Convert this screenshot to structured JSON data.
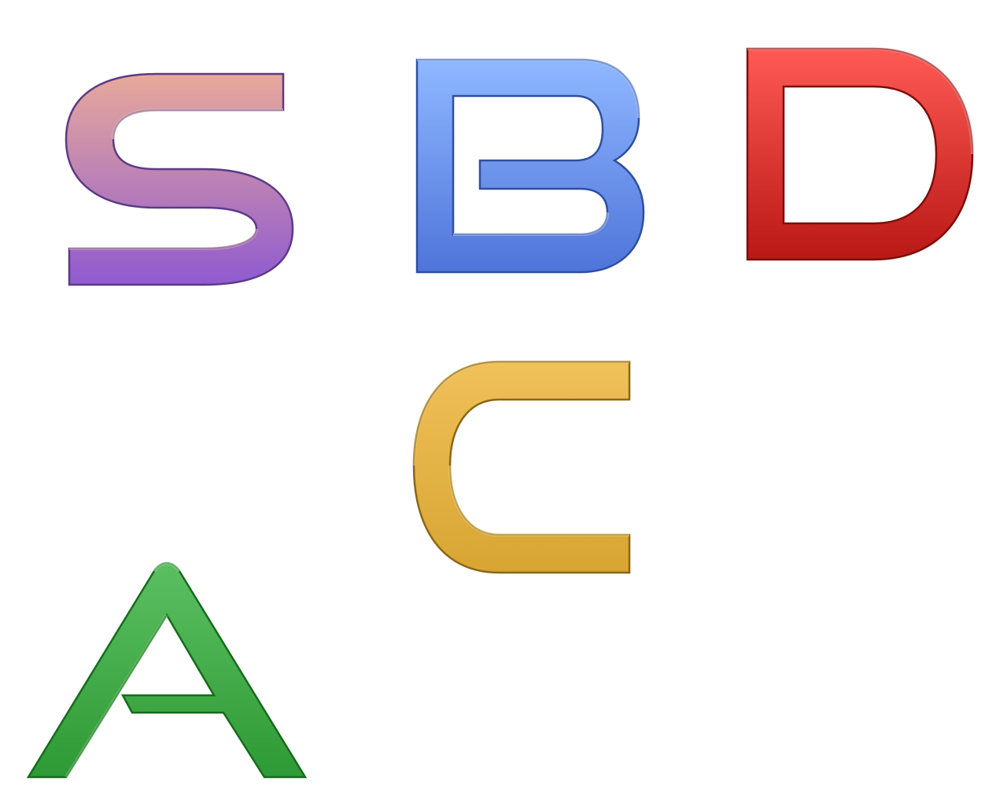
{
  "letters": [
    {
      "id": "s",
      "char": "S",
      "colors": {
        "top": "#e8a99a",
        "bottom": "#8f5ad0",
        "dark": "#5b3a86",
        "light": "#f3d2c8"
      }
    },
    {
      "id": "b",
      "char": "B",
      "colors": {
        "top": "#8fb8ff",
        "bottom": "#4f74da",
        "dark": "#2f4f9e",
        "light": "#cfe0ff"
      }
    },
    {
      "id": "d",
      "char": "D",
      "colors": {
        "top": "#ff5a55",
        "bottom": "#b91815",
        "dark": "#7d0d0a",
        "light": "#ffc2bf"
      }
    },
    {
      "id": "c",
      "char": "C",
      "colors": {
        "top": "#f0c15a",
        "bottom": "#d8a532",
        "dark": "#8a6616",
        "light": "#ffe9a7"
      }
    },
    {
      "id": "a",
      "char": "A",
      "colors": {
        "top": "#5bbf62",
        "bottom": "#2e9a34",
        "dark": "#176b1c",
        "light": "#b9f0b8"
      }
    }
  ]
}
